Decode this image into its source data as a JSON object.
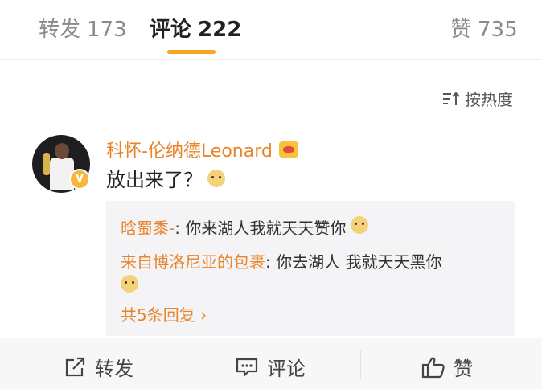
{
  "tabs": {
    "repost": {
      "label": "转发",
      "count": "173"
    },
    "comment": {
      "label": "评论",
      "count": "222"
    },
    "like": {
      "label": "赞",
      "count": "735"
    }
  },
  "sort": {
    "label": "按热度",
    "icon": "sort-icon"
  },
  "comment": {
    "username": "科怀-伦纳德Leonard",
    "verified_badge": "V",
    "text": "放出来了？"
  },
  "replies": [
    {
      "user": "晗蜀黍-",
      "text": ": 你来湖人我就天天赞你"
    },
    {
      "user": "来自博洛尼亚的包裹",
      "text": ": 你去湖人 我就天天黑你"
    }
  ],
  "more_replies": "共5条回复 ›",
  "bottom_bar": {
    "repost": "转发",
    "comment": "评论",
    "like": "赞"
  },
  "colors": {
    "accent": "#f6a623",
    "username": "#e8842b"
  }
}
